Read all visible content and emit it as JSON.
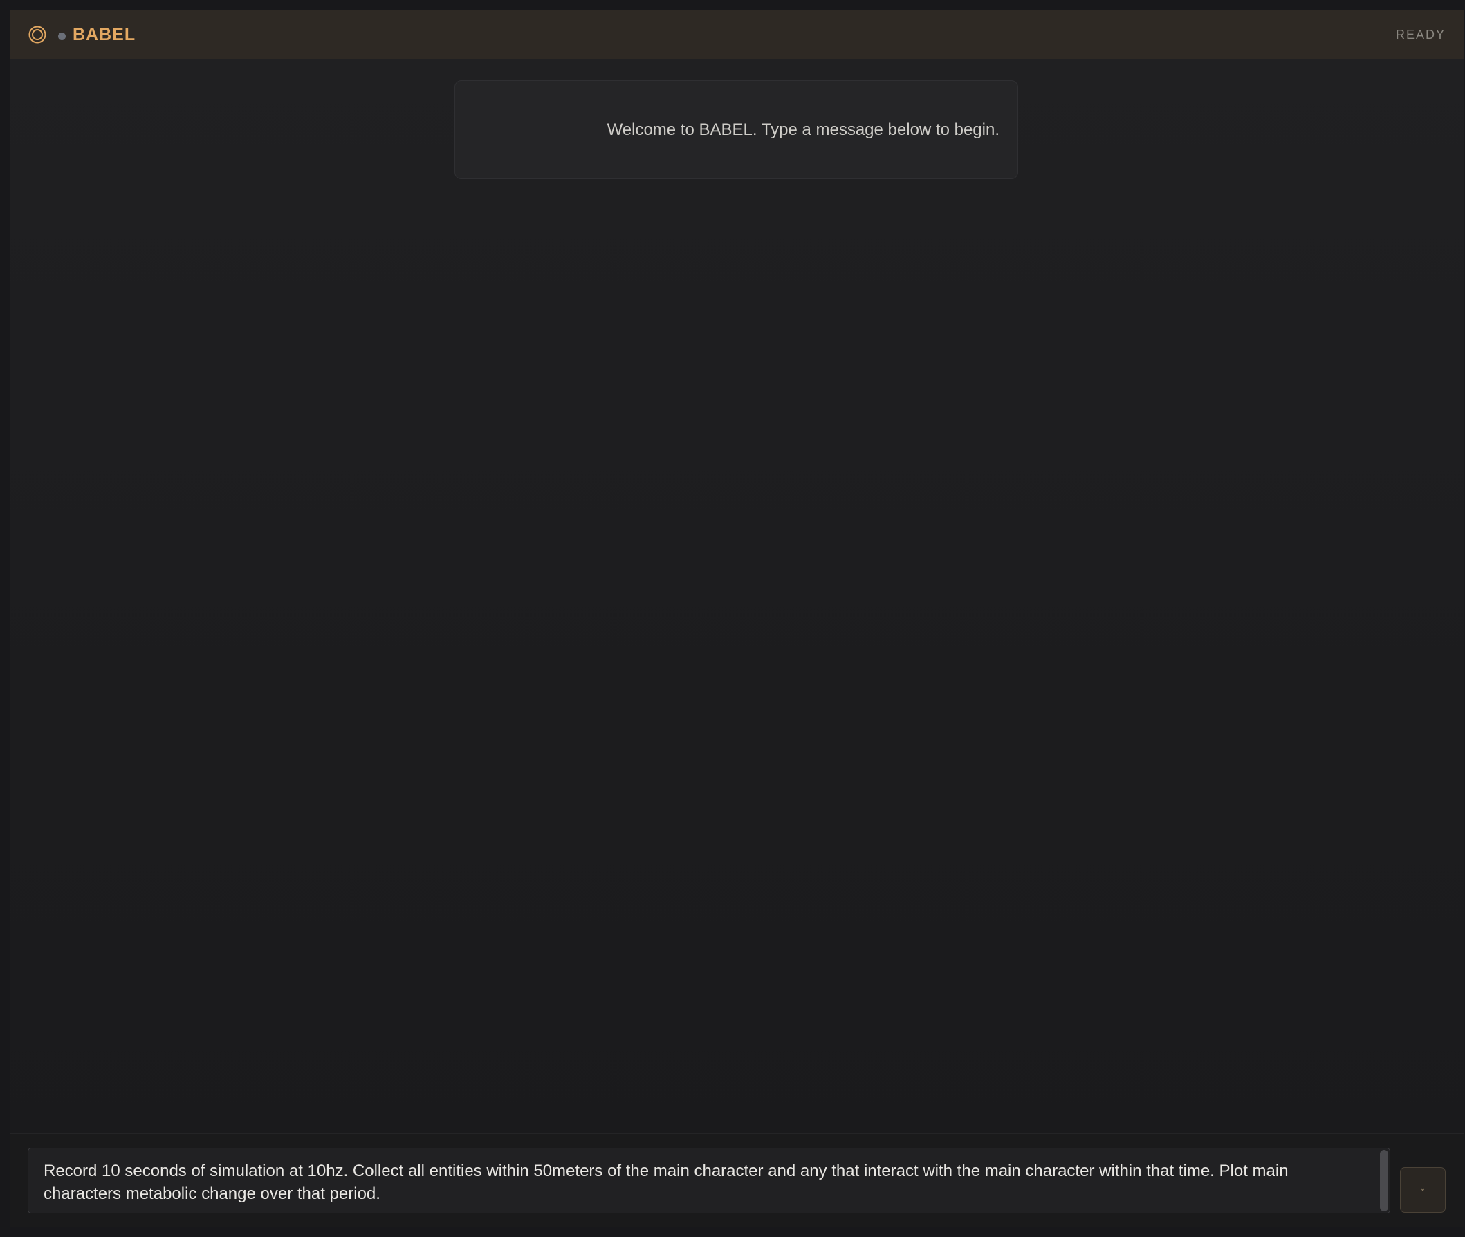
{
  "header": {
    "brand": "BABEL",
    "status": "READY",
    "accent_color": "#e3a862",
    "logo_icon": "concentric-circle-icon",
    "status_dot_icon": "status-dot-icon"
  },
  "messages": {
    "welcome": "Welcome to BABEL. Type a message below to begin."
  },
  "composer": {
    "input_value": "Record 10 seconds of simulation at 10hz. Collect all entities within 50meters of the main character and any that interact with the main character within that time. Plot main characters metabolic change over that period.",
    "send_icon": "send-icon"
  }
}
